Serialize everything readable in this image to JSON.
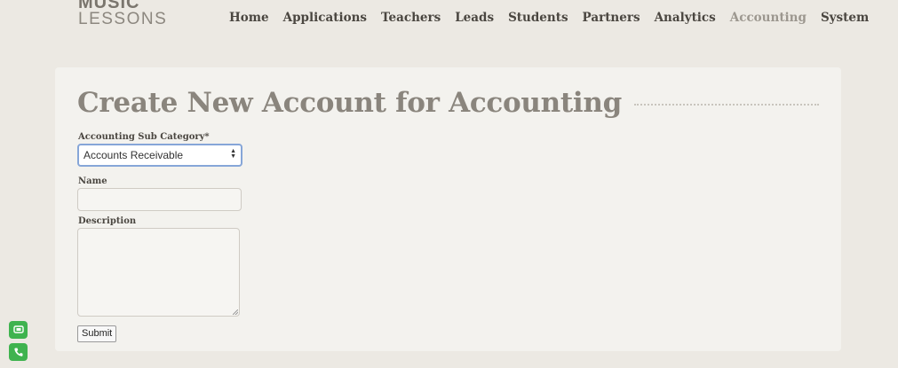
{
  "logo": {
    "line1": "MUSIC",
    "line2": "LESSONS"
  },
  "nav": {
    "items": [
      {
        "label": "Home"
      },
      {
        "label": "Applications"
      },
      {
        "label": "Teachers"
      },
      {
        "label": "Leads"
      },
      {
        "label": "Students"
      },
      {
        "label": "Partners"
      },
      {
        "label": "Analytics"
      },
      {
        "label": "Accounting",
        "active": true
      },
      {
        "label": "System"
      }
    ]
  },
  "page": {
    "title": "Create New Account for Accounting"
  },
  "form": {
    "subcategory_label": "Accounting Sub Category*",
    "subcategory_value": "Accounts Receivable",
    "name_label": "Name",
    "name_value": "",
    "description_label": "Description",
    "description_value": "",
    "submit_label": "Submit"
  },
  "side_icons": [
    "chat-icon",
    "phone-icon"
  ],
  "colors": {
    "accent_green": "#3fb34f",
    "active_nav": "#9c978f",
    "focus_border": "#86a6d8"
  }
}
